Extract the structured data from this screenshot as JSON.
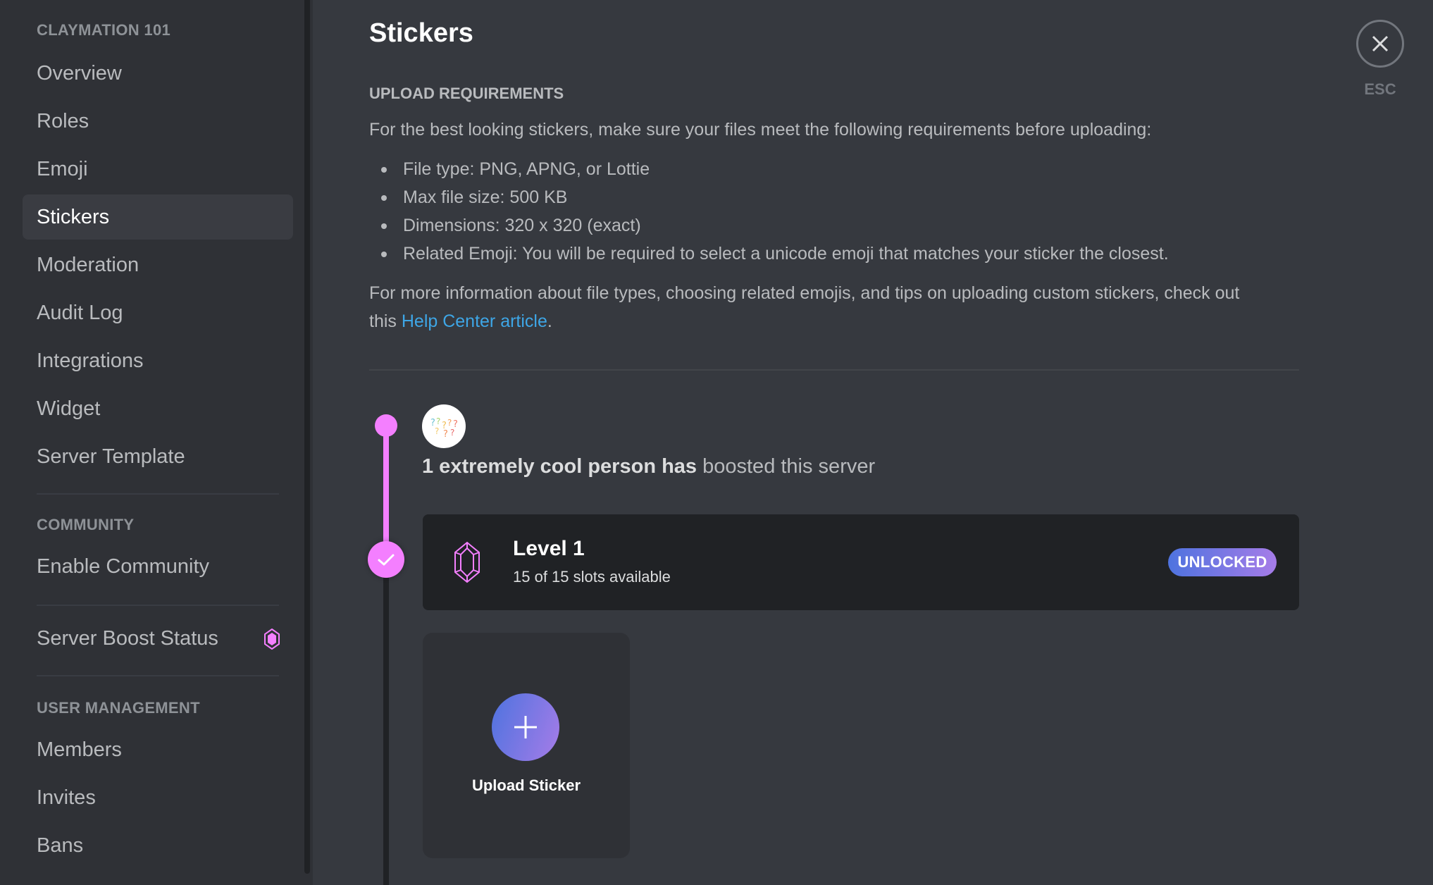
{
  "sidebar": {
    "server_header": "CLAYMATION 101",
    "items": [
      {
        "label": "Overview"
      },
      {
        "label": "Roles"
      },
      {
        "label": "Emoji"
      },
      {
        "label": "Stickers",
        "selected": true
      },
      {
        "label": "Moderation"
      },
      {
        "label": "Audit Log"
      },
      {
        "label": "Integrations"
      },
      {
        "label": "Widget"
      },
      {
        "label": "Server Template"
      }
    ],
    "community_header": "COMMUNITY",
    "community_items": [
      {
        "label": "Enable Community"
      }
    ],
    "boost_item": {
      "label": "Server Boost Status",
      "icon": "boost-gem-icon"
    },
    "user_management_header": "USER MANAGEMENT",
    "user_management_items": [
      {
        "label": "Members"
      },
      {
        "label": "Invites"
      },
      {
        "label": "Bans"
      }
    ]
  },
  "main": {
    "title": "Stickers",
    "upload_requirements": {
      "label": "UPLOAD REQUIREMENTS",
      "intro": "For the best looking stickers, make sure your files meet the following requirements before uploading:",
      "items": [
        "File type: PNG, APNG, or Lottie",
        "Max file size: 500 KB",
        "Dimensions: 320 x 320 (exact)",
        "Related Emoji: You will be required to select a unicode emoji that matches your sticker the closest."
      ],
      "more_info_line1": "For more information about file types, choosing related emojis, and tips on uploading custom stickers, check out",
      "more_info_prefix": "this ",
      "help_link": "Help Center article",
      "more_info_suffix": "."
    },
    "boost": {
      "count_bold": "1 extremely cool person has",
      "count_rest": " boosted this server"
    },
    "level": {
      "title": "Level 1",
      "slots": "15 of 15 slots available",
      "badge": "UNLOCKED"
    },
    "upload_button": {
      "label": "Upload Sticker",
      "icon": "plus-icon"
    }
  },
  "close": {
    "label": "ESC",
    "icon": "close-icon"
  },
  "colors": {
    "accent_pink": "#f47fff",
    "link_blue": "#3ea6e6",
    "gradient_start": "#4e73df",
    "gradient_end": "#a67ce8"
  }
}
